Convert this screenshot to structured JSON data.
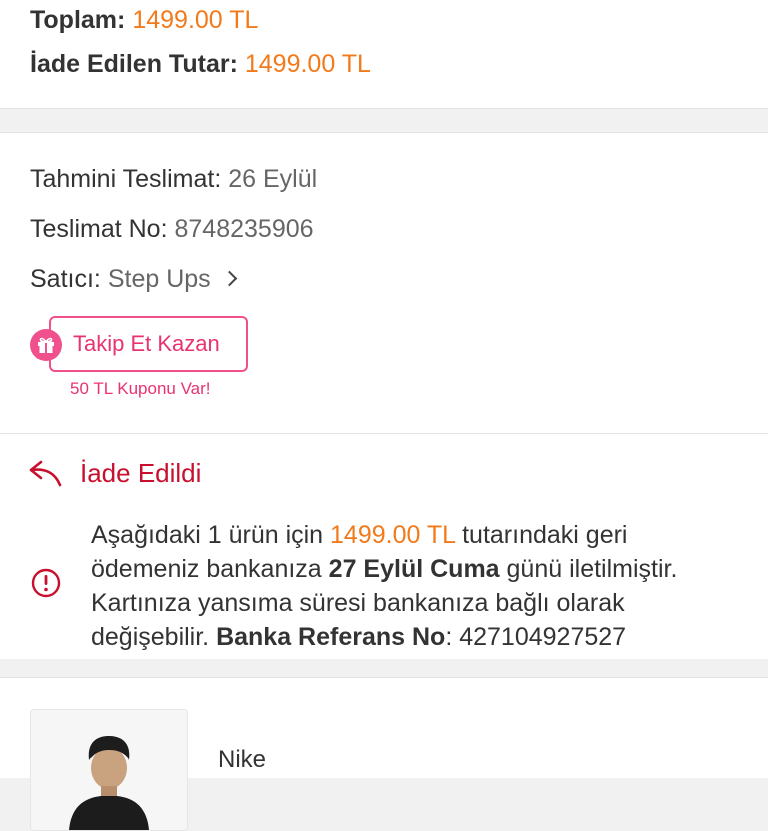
{
  "totals": {
    "total_label": "Toplam:",
    "total_value": "1499.00 TL",
    "refunded_label": "İade Edilen Tutar:",
    "refunded_value": "1499.00 TL"
  },
  "delivery": {
    "estimated_label": "Tahmini Teslimat:",
    "estimated_value": "26 Eylül",
    "delivery_no_label": "Teslimat No:",
    "delivery_no_value": "8748235906",
    "seller_label": "Satıcı:",
    "seller_value": "Step Ups",
    "follow_button": "Takip Et Kazan",
    "coupon_text": "50 TL Kuponu Var!"
  },
  "refund": {
    "status": "İade Edildi",
    "msg_1": "Aşağıdaki 1 ürün için ",
    "msg_amount": "1499.00 TL",
    "msg_2": " tutarındaki geri ödemeniz bankanıza ",
    "msg_date": "27 Eylül Cuma",
    "msg_3": " günü iletilmiştir. Kartınıza yansıma süresi bankanıza bağlı olarak değişebilir. ",
    "msg_ref_label": "Banka Referans No",
    "msg_ref_value": ": 427104927527"
  },
  "product": {
    "brand": "Nike"
  },
  "colors": {
    "accent_orange": "#f27a1a",
    "refund_red": "#c8102e",
    "pink": "#f0508c"
  },
  "icons": [
    "gift-icon",
    "chevron-right-icon",
    "return-arrow-icon",
    "info-icon"
  ]
}
